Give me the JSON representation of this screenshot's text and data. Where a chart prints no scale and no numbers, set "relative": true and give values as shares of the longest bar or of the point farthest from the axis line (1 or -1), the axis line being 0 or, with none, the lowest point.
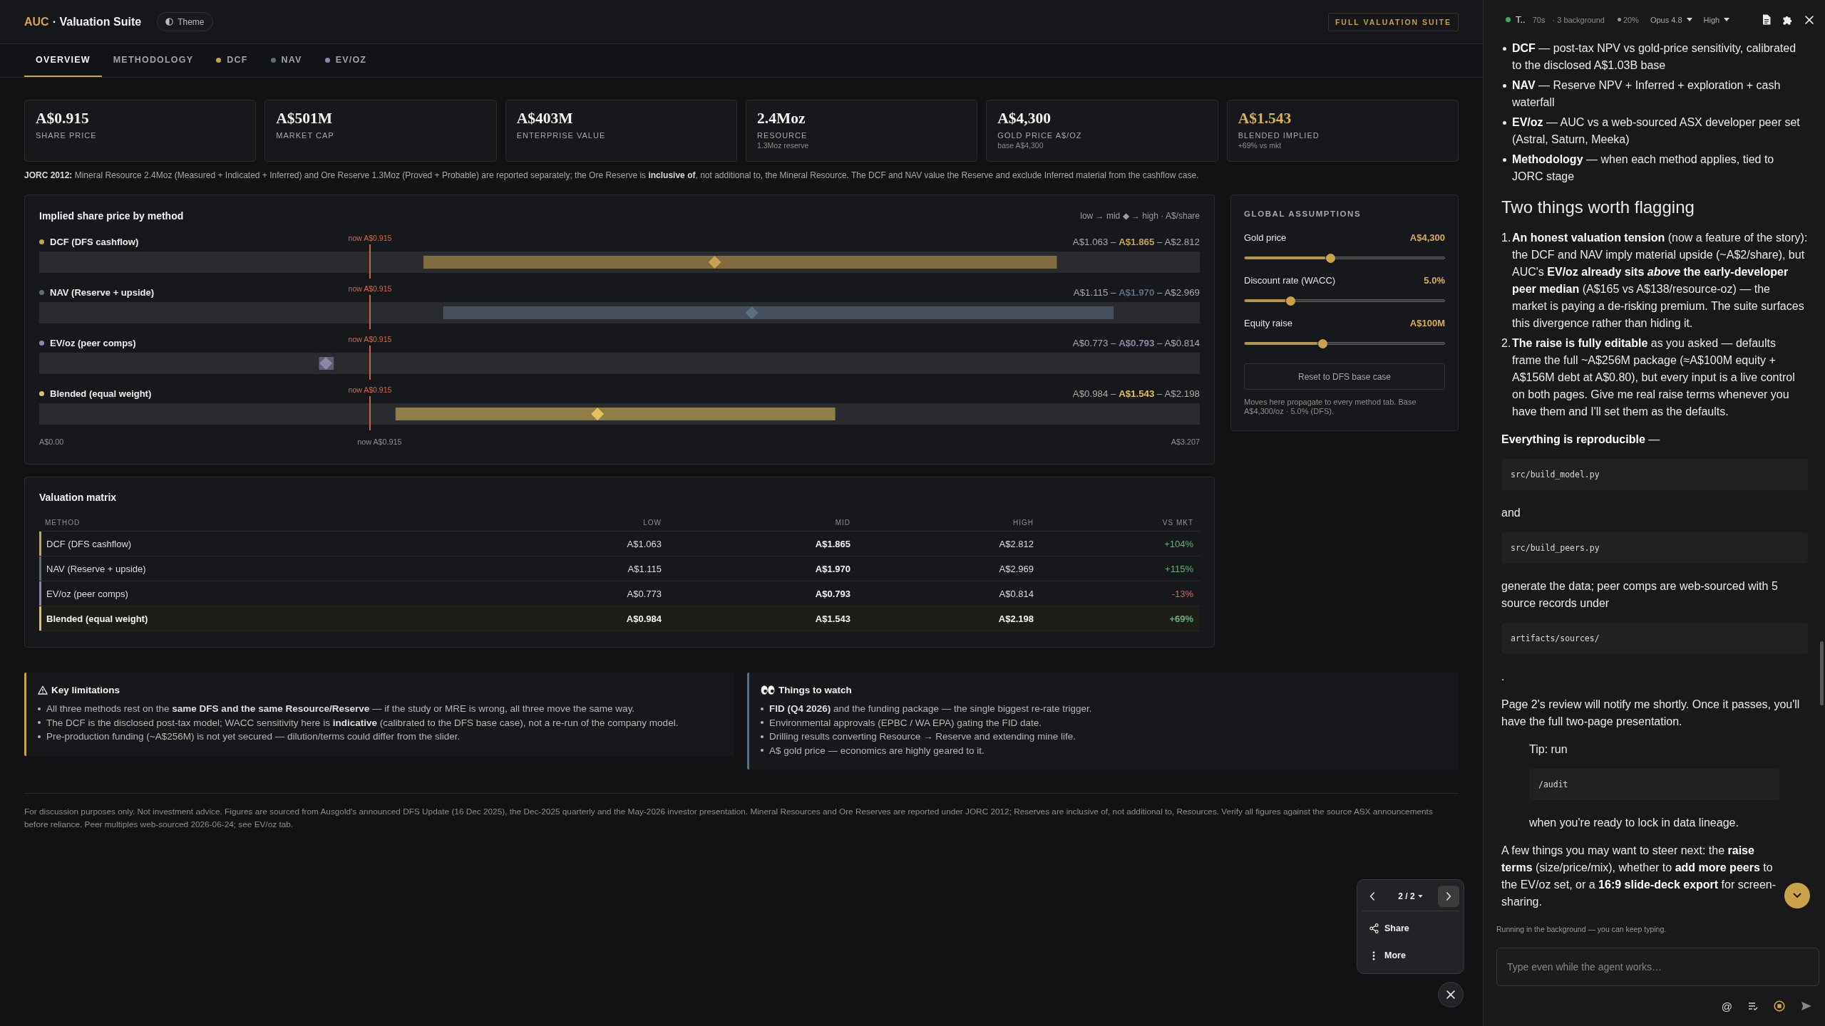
{
  "app_header": {
    "brand": "AUC",
    "title": "· Valuation Suite",
    "theme_button": "Theme",
    "badge": "FULL VALUATION SUITE"
  },
  "tabs": [
    {
      "label": "OVERVIEW",
      "selected": true
    },
    {
      "label": "METHODOLOGY",
      "selected": false
    },
    {
      "label": "DCF",
      "selected": false,
      "color": "#c9a24a"
    },
    {
      "label": "NAV",
      "selected": false,
      "color": "#5b6e80"
    },
    {
      "label": "EV/OZ",
      "selected": false,
      "color": "#8f86ad"
    }
  ],
  "kpi_cards": [
    {
      "value": "A$0.915",
      "label": "SHARE PRICE",
      "highlighted": false
    },
    {
      "value": "A$501M",
      "label": "MARKET CAP",
      "highlighted": false
    },
    {
      "value": "A$403M",
      "label": "ENTERPRISE VALUE",
      "highlighted": false
    },
    {
      "value": "2.4Moz",
      "label": "RESOURCE",
      "note": "1.3Moz reserve",
      "highlighted": false
    },
    {
      "value": "A$4,300",
      "label": "GOLD PRICE A$/OZ",
      "note": "base A$4,300",
      "highlighted": false
    },
    {
      "value": "A$1.543",
      "label": "BLENDED IMPLIED",
      "note": "+69% vs mkt",
      "highlighted": true
    }
  ],
  "jorc_note": "**JORC 2012:** Mineral Resource 2.4Moz (Measured + Indicated + Inferred) and Ore Reserve 1.3Moz (Proved + Probable) are reported separately; the Ore Reserve is **inclusive of**, not additional to, the Mineral Resource. The DCF and NAV value the Reserve and exclude Inferred material from the cashflow case.",
  "price_chart": {
    "legend": "low → mid ◆ → high · A$/share",
    "reference": {
      "level": 0.285
    },
    "rows": [
      {
        "color": "#c9a24a",
        "range": "A$1.063 – **A$1.865** – A$2.812",
        "reference_label": "now A$0.915",
        "level": 0.582
      },
      {
        "color": "#5b6e80",
        "range": "A$1.115 – **A$1.970** – A$2.969",
        "reference_label": "now A$0.915",
        "level": 0.614
      },
      {
        "color": "#8f86ad",
        "range": "A$0.773 – **A$0.793** – A$0.814",
        "reference_label": "now A$0.915",
        "level": 0.247
      },
      {
        "color": "#e3c15a",
        "range": "A$0.984 – **A$1.543** – A$2.198",
        "reference_label": "now A$0.915",
        "level": 0.481
      }
    ],
    "axis_labels": [
      {
        "kind": "start",
        "text": "A$0.00"
      },
      {
        "kind": "reference",
        "text": "now A$0.915"
      },
      {
        "kind": "end",
        "text": "A$3.207"
      }
    ],
    "chart_data": {
      "type": "bar",
      "orientation": "horizontal",
      "stacked": true,
      "relative": true,
      "title": "Implied share price by method",
      "categories": [
        "DCF (DFS cashflow)",
        "NAV (Reserve + upside)",
        "EV/oz (peer comps)",
        "Blended (equal weight)"
      ],
      "series": [
        {
          "values": [
            0.331,
            0.348,
            0.241,
            0.307
          ]
        },
        {
          "values": [
            0.546,
            0.578,
            0.013,
            0.379
          ]
        },
        {
          "values": [
            0.123,
            0.074,
            0.746,
            0.314
          ]
        }
      ]
    }
  },
  "assumptions": {
    "title": "GLOBAL ASSUMPTIONS",
    "sliders": [
      {
        "label": "Gold price",
        "reading": "A$4,300",
        "level": 0.43
      },
      {
        "label": "Discount rate (WACC)",
        "reading": "5.0%",
        "level": 0.23
      },
      {
        "label": "Equity raise",
        "reading": "A$100M",
        "level": 0.39
      }
    ],
    "reset_button": "Reset to DFS base case",
    "note": "Moves here propagate to every method tab. Base A$4,300/oz · 5.0% (DFS)."
  },
  "matrix": {
    "title": "Valuation matrix",
    "columns": [
      "METHOD",
      "LOW",
      "MID",
      "HIGH",
      "VS MKT"
    ],
    "rows": [
      {
        "kind": "method",
        "color": "#c9a24a",
        "positive": true,
        "cells": [
          "DCF (DFS cashflow)",
          "A$1.063",
          "A$1.865",
          "A$2.812",
          "+104%"
        ]
      },
      {
        "kind": "method",
        "color": "#5b6e80",
        "positive": true,
        "cells": [
          "NAV (Reserve + upside)",
          "A$1.115",
          "A$1.970",
          "A$2.969",
          "+115%"
        ]
      },
      {
        "kind": "method",
        "color": "#8f86ad",
        "positive": false,
        "cells": [
          "EV/oz (peer comps)",
          "A$0.773",
          "A$0.793",
          "A$0.814",
          "-13%"
        ]
      },
      {
        "kind": "total",
        "color": "#e3c15a",
        "positive": true,
        "cells": [
          "Blended (equal weight)",
          "A$0.984",
          "A$1.543",
          "A$2.198",
          "+69%"
        ]
      }
    ]
  },
  "callouts": [
    {
      "kind": "warning",
      "color": "#c9a24a",
      "title": "Key limitations",
      "items": [
        "All three methods rest on the **same DFS and the same Resource/Reserve** — if the study or MRE is wrong, all three move the same way.",
        "The DCF is the disclosed post-tax model; WACC sensitivity here is **indicative** (calibrated to the DFS base case), not a re-run of the company model.",
        "Pre-production funding (~A$256M) is not yet secured — dilution/terms could differ from the slider."
      ]
    },
    {
      "kind": "watch",
      "color": "#5b6e80",
      "title": "Things to watch",
      "items": [
        "**FID (Q4 2026)** and the funding package — the single biggest re-rate trigger.",
        "Environmental approvals (EPBC / WA EPA) gating the FID date.",
        "Drilling results converting Resource → Reserve and extending mine life.",
        "A$ gold price — economics are highly geared to it."
      ]
    }
  ],
  "footer": "For discussion purposes only. Not investment advice. Figures are sourced from Ausgold's announced DFS Update (16 Dec 2025), the Dec-2025 quarterly and the May-2026 investor presentation. Mineral Resources and Ore Reserves are reported under JORC 2012; Reserves are inclusive of, not additional to, Resources. Verify all figures against the source ASX announcements before reliance. Peer multiples web-sourced 2026-06-24; see EV/oz tab.",
  "pager": {
    "page": "2 / 2",
    "buttons": [
      {
        "kind": "prev",
        "hovered": false
      },
      {
        "kind": "next",
        "hovered": true
      }
    ],
    "actions": [
      {
        "kind": "share",
        "label": "Share"
      },
      {
        "kind": "more",
        "label": "More"
      }
    ]
  },
  "agent_panel": {
    "status": {
      "task": "T..",
      "elapsed": "70s",
      "background": "· 3 background",
      "context": "20%",
      "model": "Opus 4.8",
      "effort": "High"
    },
    "blocks": [
      {
        "kind": "bullets",
        "items": [
          "**DCF** — post-tax NPV vs gold-price sensitivity, calibrated to the disclosed A$1.03B base",
          "**NAV** — Reserve NPV + Inferred + exploration + cash waterfall",
          "**EV/oz** — AUC vs a web-sourced ASX developer peer set (Astral, Saturn, Meeka)",
          "**Methodology** — when each method applies, tied to JORC stage"
        ]
      },
      {
        "kind": "heading",
        "text": "Two things worth flagging"
      },
      {
        "kind": "numbered",
        "items": [
          {
            "number": "1.",
            "text": "**An honest valuation tension** (now a feature of the story): the DCF and NAV imply material upside (~A$2/share), but AUC's **EV/oz already sits *above* the early-developer peer median** (A$165 vs A$138/resource-oz) — the market is paying a de-risking premium. The suite surfaces this divergence rather than hiding it."
          },
          {
            "number": "2.",
            "text": "**The raise is fully editable** as you asked — defaults frame the full ~A$256M package (≈A$100M equity + A$156M debt at A$0.80), but every input is a live control on both pages. Give me real raise terms whenever you have them and I'll set them as the defaults."
          }
        ]
      },
      {
        "kind": "paragraph",
        "text": "**Everything is reproducible** —"
      },
      {
        "kind": "code",
        "text": "src/build_model.py"
      },
      {
        "kind": "paragraph",
        "text": "and"
      },
      {
        "kind": "code",
        "text": "src/build_peers.py"
      },
      {
        "kind": "paragraph",
        "text": "generate the data; peer comps are web-sourced with 5 source records under"
      },
      {
        "kind": "code",
        "text": "artifacts/sources/"
      },
      {
        "kind": "paragraph",
        "text": "."
      },
      {
        "kind": "paragraph",
        "text": "Page 2's review will notify me shortly. Once it passes, you'll have the full two-page presentation."
      },
      {
        "kind": "tip",
        "blocks": [
          {
            "kind": "paragraph",
            "text": "Tip: run"
          },
          {
            "kind": "code",
            "text": "/audit"
          },
          {
            "kind": "paragraph",
            "text": "when you're ready to lock in data lineage."
          }
        ]
      },
      {
        "kind": "paragraph",
        "text": "A few things you may want to steer next: the **raise terms** (size/price/mix), whether to **add more peers** to the EV/oz set, or a **16:9 slide-deck export** for screen-sharing."
      }
    ],
    "composer": {
      "status_note": "Running in the background — you can keep typing.",
      "placeholder": "Type even while the agent works…",
      "mention_key": "@"
    }
  }
}
